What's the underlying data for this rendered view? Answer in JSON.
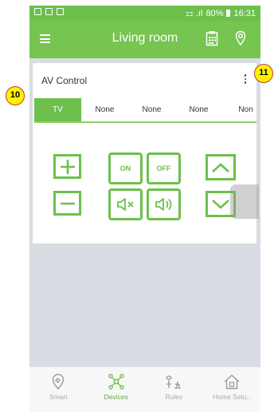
{
  "status_bar": {
    "signal_text": "⚏ .ıl",
    "battery": "80%",
    "time": "16:31"
  },
  "header": {
    "title": "Living room"
  },
  "card": {
    "title": "AV Control"
  },
  "tabs": [
    {
      "label": "TV",
      "active": true
    },
    {
      "label": "None"
    },
    {
      "label": "None"
    },
    {
      "label": "None"
    },
    {
      "label": "Non"
    }
  ],
  "controls": {
    "on_label": "ON",
    "off_label": "OFF"
  },
  "bottom_nav": [
    {
      "label": "Smart",
      "icon": "smart-icon"
    },
    {
      "label": "Devices",
      "icon": "devices-icon",
      "active": true
    },
    {
      "label": "Rules",
      "icon": "rules-icon"
    },
    {
      "label": "Home Setu..",
      "icon": "home-setup-icon"
    }
  ],
  "annotations": {
    "badge_10": "10",
    "badge_11": "11"
  },
  "colors": {
    "accent": "#76c551",
    "status_bar": "#6dc04c",
    "background": "#d8dce3"
  }
}
